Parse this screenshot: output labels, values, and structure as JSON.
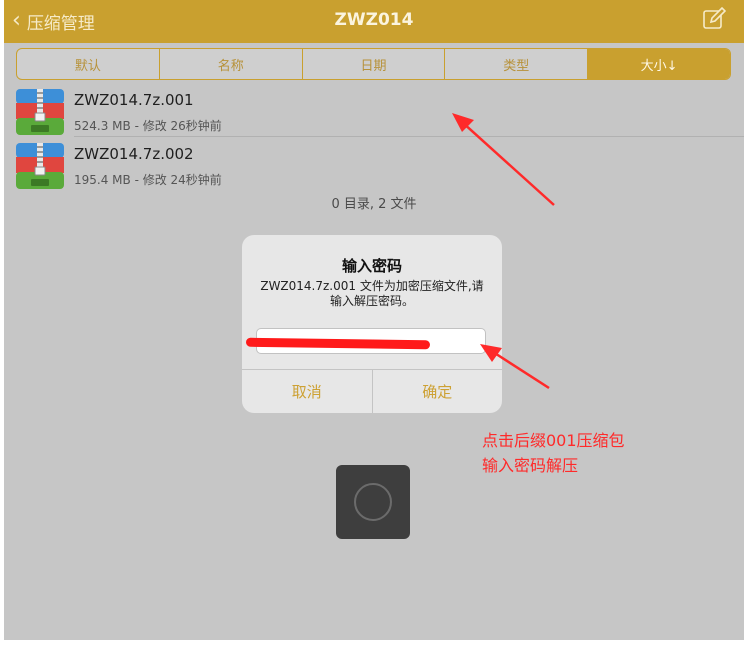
{
  "navbar": {
    "back_label": "压缩管理",
    "title": "ZWZ014"
  },
  "sort_tabs": [
    {
      "label": "默认",
      "active": false
    },
    {
      "label": "名称",
      "active": false
    },
    {
      "label": "日期",
      "active": false
    },
    {
      "label": "类型",
      "active": false
    },
    {
      "label": "大小↓",
      "active": true
    }
  ],
  "files": [
    {
      "name": "ZWZ014.7z.001",
      "meta": "524.3 MB - 修改 26秒钟前",
      "icon": "zip-archive-icon"
    },
    {
      "name": "ZWZ014.7z.002",
      "meta": "195.4 MB - 修改 24秒钟前",
      "icon": "zip-archive-icon"
    }
  ],
  "summary": "0 目录, 2 文件",
  "dialog": {
    "title": "输入密码",
    "message": "ZWZ014.7z.001 文件为加密压缩文件,请输入解压密码。",
    "password_value": "",
    "cancel_label": "取消",
    "confirm_label": "确定"
  },
  "annotation": {
    "line1": "点击后缀001压缩包",
    "line2": "输入密码解压"
  },
  "colors": {
    "accent": "#c9a02f",
    "annotation_red": "#ff2a2a"
  }
}
